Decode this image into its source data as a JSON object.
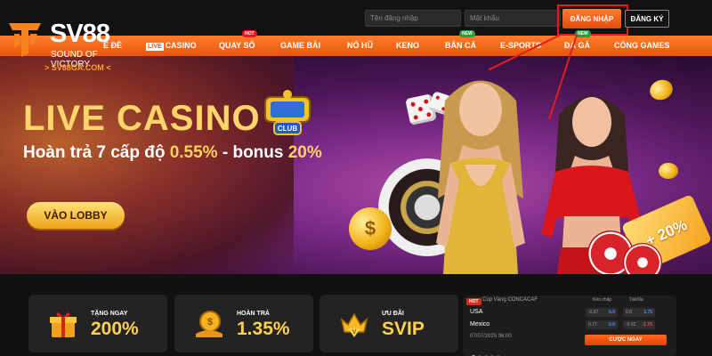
{
  "header": {
    "logo_text": "SV88",
    "logo_slogan": "SOUND OF VICTORY",
    "logo_domain": "> SV88GA.COM <",
    "username_placeholder": "Tên đăng nhập",
    "password_placeholder": "Mật khẩu",
    "login_label": "ĐĂNG NHẬP",
    "register_label": "ĐĂNG KÝ"
  },
  "nav": {
    "items": [
      {
        "label": "Ể ĐỀ",
        "tag": ""
      },
      {
        "label": "CASINO",
        "chip": "LIVE",
        "tag": ""
      },
      {
        "label": "QUAY SỐ",
        "tag": "HOT"
      },
      {
        "label": "GAME BÀI",
        "tag": ""
      },
      {
        "label": "NỔ HŨ",
        "tag": ""
      },
      {
        "label": "KENO",
        "tag": ""
      },
      {
        "label": "BẮN CÁ",
        "tag": "NEW"
      },
      {
        "label": "E-SPORTS",
        "tag": ""
      },
      {
        "label": "ĐÁ GÀ",
        "tag": "NEW"
      },
      {
        "label": "CỔNG GAMES",
        "tag": ""
      }
    ]
  },
  "banner": {
    "title": "LIVE CASINO",
    "sub_prefix": "Hoàn trả 7 cấp độ ",
    "sub_pct": "0.55%",
    "sub_mid": " - bonus ",
    "sub_bonus": "20%",
    "lobby_label": "VÀO LOBBY",
    "club_text": "CLUB",
    "ticket_text": "+ 20%",
    "coin_symbol": "$"
  },
  "cards": [
    {
      "label": "TẶNG NGAY",
      "value": "200%"
    },
    {
      "label": "HOÀN TRẢ",
      "value": "1.35%"
    },
    {
      "label": "ƯU ĐÃI",
      "value": "SVIP"
    }
  ],
  "match": {
    "hot_tag": "HOT",
    "league": "Cúp Vàng CONCACAF",
    "col_handicap": "Kèo chấp",
    "col_overunder": "Tài/Xỉu",
    "team1": "USA",
    "team2": "Mexico",
    "datetime": "07/07/2025 06:00",
    "odds_row1": [
      {
        "a": "-0.87",
        "b": "0.0"
      },
      {
        "a": "0.8",
        "b": "1.75"
      }
    ],
    "odds_row2": [
      {
        "a": "0.77",
        "b": "0.0"
      },
      {
        "a": "-0.92",
        "b": "-1.75"
      }
    ],
    "bet_label": "CƯỢC NGAY"
  },
  "colors": {
    "accent": "#f5811f",
    "nav_orange": "#ee5f10",
    "gold": "#ffd24a",
    "annotation_red": "#e21d1d",
    "odds_blue": "#4a8cff",
    "odds_red": "#ff4a4a"
  }
}
